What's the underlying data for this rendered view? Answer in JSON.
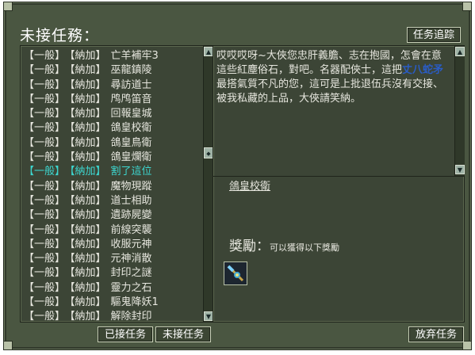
{
  "window": {
    "title": "未接任務："
  },
  "header": {
    "track_button": "任务追踪"
  },
  "quest_list": [
    {
      "category": "【一般】",
      "source": "【納加】",
      "name": "亡羊補牢3",
      "selected": false
    },
    {
      "category": "【一般】",
      "source": "【納加】",
      "name": "巫龍鎮陵",
      "selected": false
    },
    {
      "category": "【一般】",
      "source": "【納加】",
      "name": "尋訪道士",
      "selected": false
    },
    {
      "category": "【一般】",
      "source": "【納加】",
      "name": "鸤鸤笛音",
      "selected": false
    },
    {
      "category": "【一般】",
      "source": "【納加】",
      "name": "回報皇城",
      "selected": false
    },
    {
      "category": "【一般】",
      "source": "【納加】",
      "name": "鴿皇校衛",
      "selected": false
    },
    {
      "category": "【一般】",
      "source": "【納加】",
      "name": "鴿皇鳥衛",
      "selected": false
    },
    {
      "category": "【一般】",
      "source": "【納加】",
      "name": "鴿皇爛衛",
      "selected": false
    },
    {
      "category": "【一般】",
      "source": "【納加】",
      "name": "割了這位",
      "selected": true
    },
    {
      "category": "【一般】",
      "source": "【納加】",
      "name": "魔物現蹤",
      "selected": false
    },
    {
      "category": "【一般】",
      "source": "【納加】",
      "name": "道士相助",
      "selected": false
    },
    {
      "category": "【一般】",
      "source": "【納加】",
      "name": "遺跡屍變",
      "selected": false
    },
    {
      "category": "【一般】",
      "source": "【納加】",
      "name": "前線突襲",
      "selected": false
    },
    {
      "category": "【一般】",
      "source": "【納加】",
      "name": "收服元神",
      "selected": false
    },
    {
      "category": "【一般】",
      "source": "【納加】",
      "name": "元神消散",
      "selected": false
    },
    {
      "category": "【一般】",
      "source": "【納加】",
      "name": "封印之謎",
      "selected": false
    },
    {
      "category": "【一般】",
      "source": "【納加】",
      "name": "靈力之石",
      "selected": false
    },
    {
      "category": "【一般】",
      "source": "【納加】",
      "name": "驅鬼降妖1",
      "selected": false
    },
    {
      "category": "【一般】",
      "source": "【納加】",
      "name": "解除封印",
      "selected": false
    }
  ],
  "description": {
    "part1": "哎哎哎呀~大俠您忠肝義膽、志在抱國，怎會在意這些紅塵俗石，對吧。名器配俠士，這把",
    "highlight": "丈八蛇矛",
    "part2": "最搭氣質不凡的您，這可是上批退伍兵沒有交接、被我私藏的上品，大俠請笑納。"
  },
  "quest_detail": {
    "name": "鴿皇校衛"
  },
  "reward": {
    "title": "獎勵：",
    "subtitle": "可以獲得以下獎勵",
    "item_icon": "spear-icon"
  },
  "footer": {
    "accepted_tab": "已接任务",
    "unaccepted_tab": "未接任务",
    "abandon_button": "放弃任务"
  },
  "colors": {
    "selected_text": "#3dd7d0",
    "highlight_text": "#2a5cc4",
    "frame": "#4a5641"
  }
}
